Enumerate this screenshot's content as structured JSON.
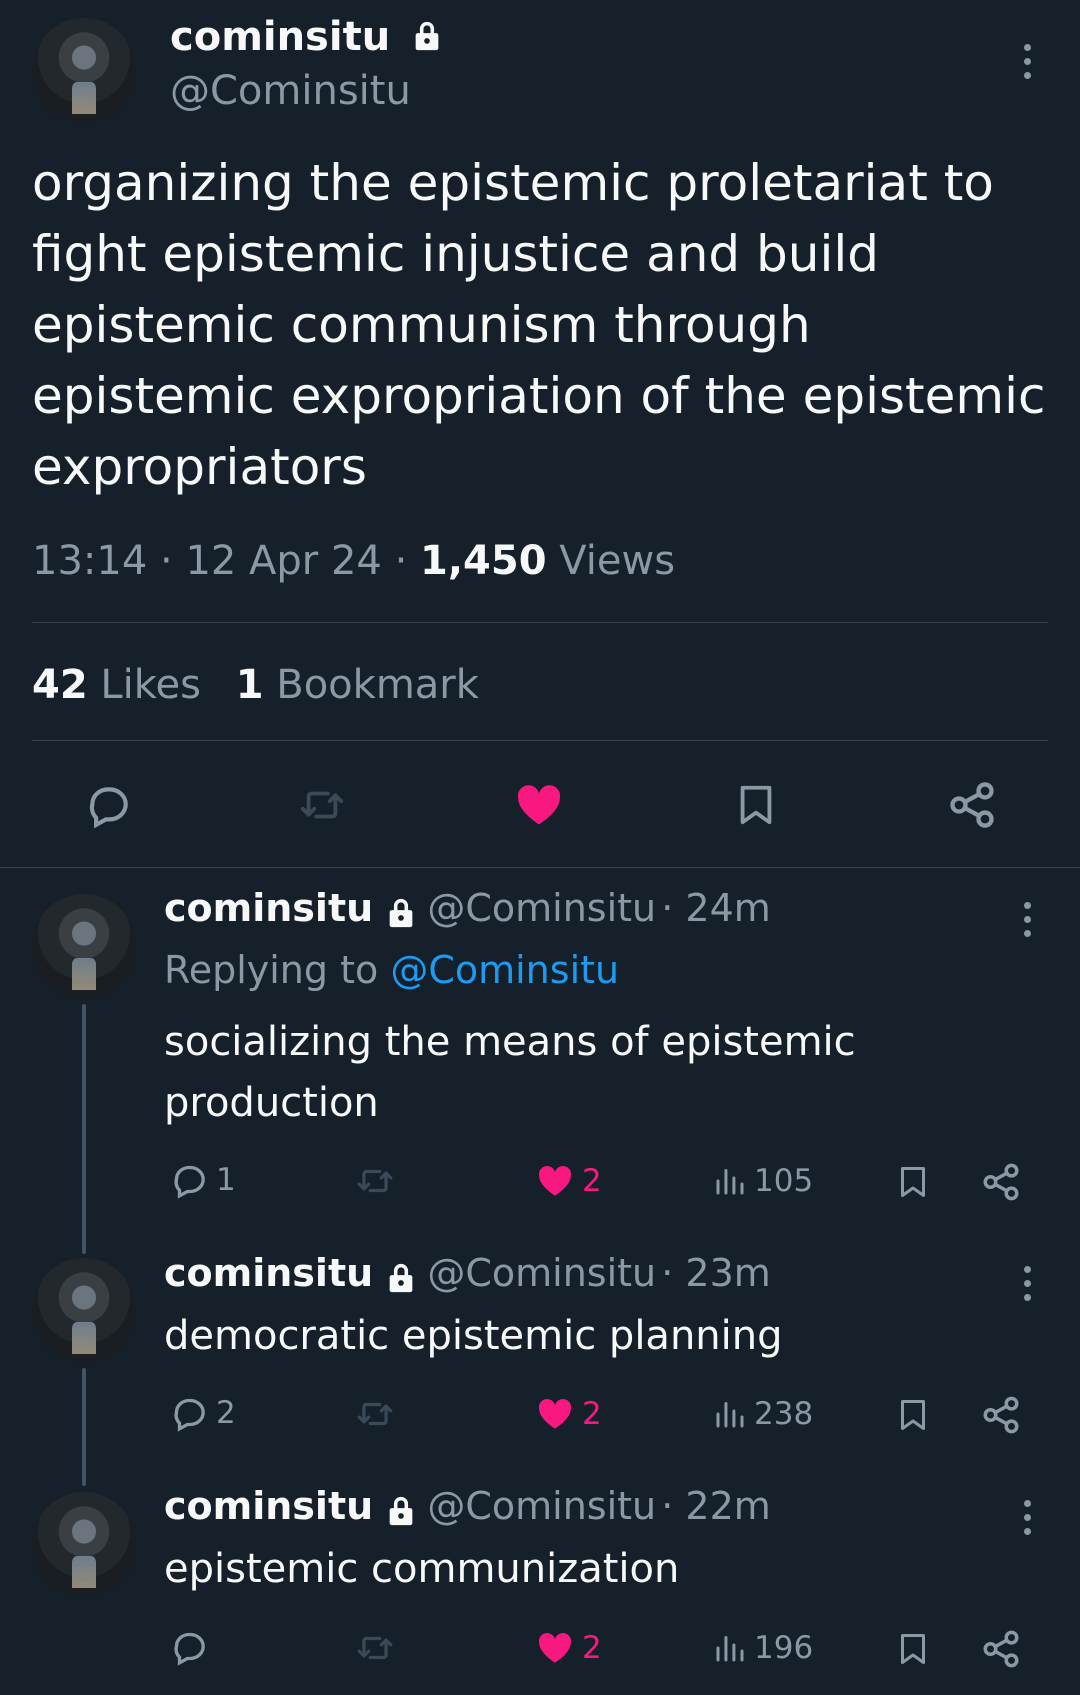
{
  "main_tweet": {
    "name": "cominsitu",
    "handle": "@Cominsitu",
    "text": "organizing the epistemic proletariat to fight epistemic injustice and build epistemic communism through epistemic expropriation of the epistemic expropriators",
    "time": "13:14",
    "date": "12 Apr 24",
    "views_count": "1,450",
    "views_label": "Views",
    "likes_count": "42",
    "likes_label": "Likes",
    "bookmarks_count": "1",
    "bookmarks_label": "Bookmark"
  },
  "replies": [
    {
      "name": "cominsitu",
      "handle": "@Cominsitu",
      "age": "24m",
      "replying_label": "Replying to",
      "replying_to": "@Cominsitu",
      "text": "socializing the means of epistemic production",
      "reply_count": "1",
      "like_count": "2",
      "view_count": "105"
    },
    {
      "name": "cominsitu",
      "handle": "@Cominsitu",
      "age": "23m",
      "text": "democratic epistemic planning",
      "reply_count": "2",
      "like_count": "2",
      "view_count": "238"
    },
    {
      "name": "cominsitu",
      "handle": "@Cominsitu",
      "age": "22m",
      "text": "epistemic communization",
      "reply_count": "",
      "like_count": "2",
      "view_count": "196"
    }
  ],
  "colors": {
    "background": "#15202b",
    "text": "#f7f9f9",
    "muted": "#8b98a5",
    "like": "#f91880",
    "link": "#1d9bf0",
    "divider": "#38444d"
  },
  "icons": {
    "lock": "lock-icon",
    "more": "more-icon",
    "reply": "reply-icon",
    "retweet": "retweet-icon",
    "like": "heart-icon",
    "views": "views-icon",
    "bookmark": "bookmark-icon",
    "share": "share-icon"
  }
}
